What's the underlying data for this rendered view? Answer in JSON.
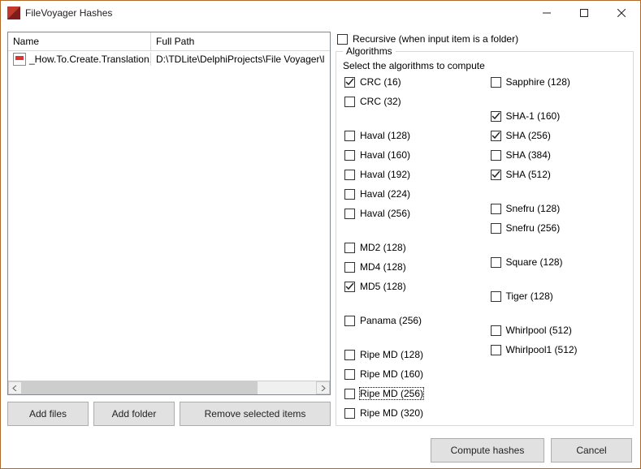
{
  "window": {
    "title": "FileVoyager Hashes"
  },
  "filelist": {
    "headers": {
      "name": "Name",
      "path": "Full Path"
    },
    "rows": [
      {
        "name": "_How.To.Create.Translation....",
        "path": "D:\\TDLite\\DelphiProjects\\File Voyager\\l"
      }
    ]
  },
  "buttons": {
    "add_files": "Add files",
    "add_folder": "Add folder",
    "remove_selected": "Remove selected items",
    "compute": "Compute hashes",
    "cancel": "Cancel"
  },
  "recursive": {
    "label": "Recursive (when input item is a folder)",
    "checked": false
  },
  "algorithms": {
    "legend": "Algorithms",
    "instruction": "Select the algorithms to compute",
    "left": [
      {
        "id": "crc16",
        "label": "CRC (16)",
        "checked": true
      },
      {
        "id": "crc32",
        "label": "CRC (32)",
        "checked": false
      },
      {
        "id": "gapA"
      },
      {
        "id": "haval128",
        "label": "Haval (128)",
        "checked": false
      },
      {
        "id": "haval160",
        "label": "Haval (160)",
        "checked": false
      },
      {
        "id": "haval192",
        "label": "Haval (192)",
        "checked": false
      },
      {
        "id": "haval224",
        "label": "Haval (224)",
        "checked": false
      },
      {
        "id": "haval256",
        "label": "Haval (256)",
        "checked": false
      },
      {
        "id": "gapB"
      },
      {
        "id": "md2",
        "label": "MD2 (128)",
        "checked": false
      },
      {
        "id": "md4",
        "label": "MD4 (128)",
        "checked": false
      },
      {
        "id": "md5",
        "label": "MD5 (128)",
        "checked": true
      },
      {
        "id": "gapC"
      },
      {
        "id": "panama",
        "label": "Panama (256)",
        "checked": false
      },
      {
        "id": "gapD"
      },
      {
        "id": "ripe128",
        "label": "Ripe MD (128)",
        "checked": false
      },
      {
        "id": "ripe160",
        "label": "Ripe MD (160)",
        "checked": false
      },
      {
        "id": "ripe256",
        "label": "Ripe MD (256)",
        "checked": false,
        "focused": true
      },
      {
        "id": "ripe320",
        "label": "Ripe MD (320)",
        "checked": false
      }
    ],
    "right": [
      {
        "id": "sapphire",
        "label": "Sapphire (128)",
        "checked": false
      },
      {
        "id": "gapE"
      },
      {
        "id": "sha1",
        "label": "SHA-1 (160)",
        "checked": true
      },
      {
        "id": "sha256",
        "label": "SHA (256)",
        "checked": true
      },
      {
        "id": "sha384",
        "label": "SHA (384)",
        "checked": false
      },
      {
        "id": "sha512",
        "label": "SHA (512)",
        "checked": true
      },
      {
        "id": "gapF"
      },
      {
        "id": "snefru128",
        "label": "Snefru (128)",
        "checked": false
      },
      {
        "id": "snefru256",
        "label": "Snefru (256)",
        "checked": false
      },
      {
        "id": "gapG"
      },
      {
        "id": "square",
        "label": "Square (128)",
        "checked": false
      },
      {
        "id": "gapH"
      },
      {
        "id": "tiger",
        "label": "Tiger (128)",
        "checked": false
      },
      {
        "id": "gapI"
      },
      {
        "id": "whirl",
        "label": "Whirlpool (512)",
        "checked": false
      },
      {
        "id": "whirl1",
        "label": "Whirlpool1 (512)",
        "checked": false
      }
    ]
  }
}
